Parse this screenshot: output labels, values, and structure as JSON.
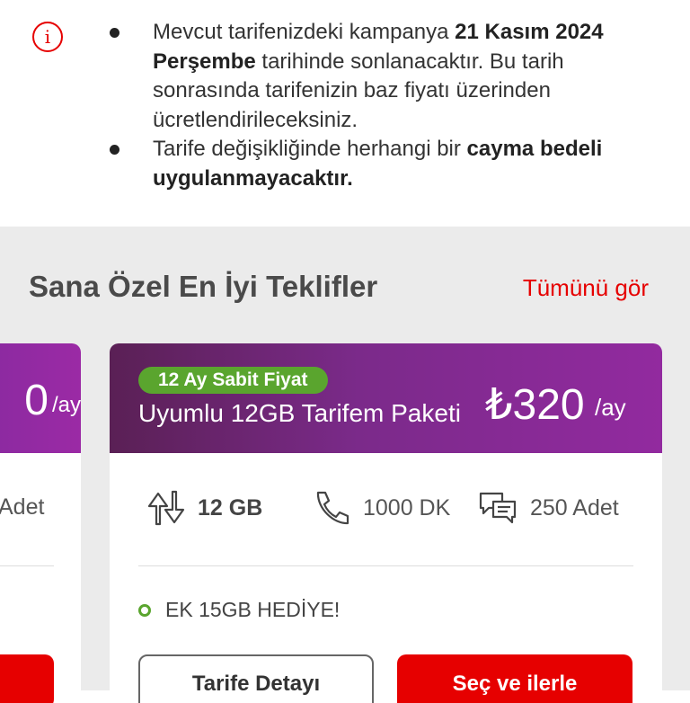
{
  "info": {
    "icon": "info-icon",
    "icon_glyph": "i",
    "bullet1": {
      "t1": "Mevcut tarifenizdeki kampanya ",
      "b1": "21 Kasım 2024 Perşembe",
      "t2": " tarihinde sonlanacaktır. Bu tarih sonrasında tarifenizin baz fiyatı üzerinden ücretlendirileceksiniz."
    },
    "bullet2": {
      "t1": "Tarife değişikliğinde herhangi bir ",
      "b1": "cayma bedeli uygulanmayacaktır."
    }
  },
  "offers": {
    "title": "Sana Özel En İyi Teklifler",
    "see_all": "Tümünü gör",
    "left_card": {
      "price_partial": "0",
      "per": "/ay",
      "sms_partial": "Adet"
    },
    "card": {
      "badge": "12 Ay Sabit Fiyat",
      "name": "Uyumlu 12GB Tarifem Paketi",
      "price": "₺320",
      "per": "/ay",
      "features": {
        "data": "12 GB",
        "minutes": "1000 DK",
        "sms": "250 Adet"
      },
      "bonus": "EK 15GB HEDİYE!",
      "detail_button": "Tarife Detayı",
      "select_button": "Seç ve ilerle"
    },
    "colors": {
      "accent": "#e60000",
      "badge": "#5aa52e",
      "header_start": "#5a2055",
      "header_end": "#922a9f",
      "background": "#ebebeb"
    }
  }
}
